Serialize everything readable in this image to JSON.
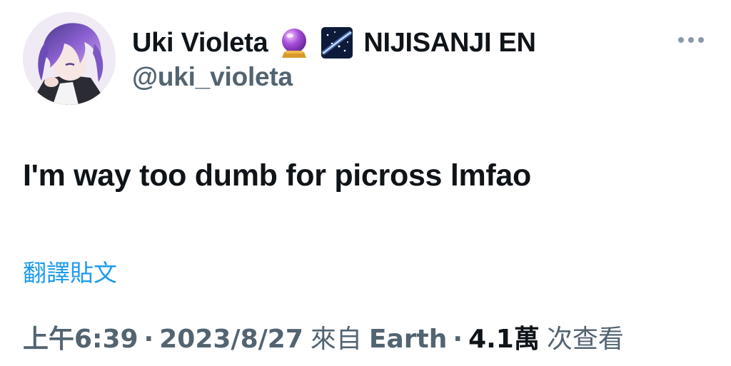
{
  "author": {
    "display_name": "Uki Violeta",
    "emoji_1": "crystal-ball-emoji",
    "emoji_2": "milky-way-emoji",
    "affiliation": "NIJISANJI EN",
    "handle": "@uki_violeta"
  },
  "tweet": {
    "text": "I'm way too dumb for picross lmfao",
    "translate_label": "翻譯貼文"
  },
  "meta": {
    "time": "上午6:39",
    "separator": "·",
    "date": "2023/8/27",
    "source_prefix": "來自",
    "source": "Earth",
    "views_count": "4.1萬",
    "views_label": "次查看"
  },
  "colors": {
    "text_primary": "#0f1419",
    "text_secondary": "#536471",
    "link": "#1d9bf0"
  }
}
